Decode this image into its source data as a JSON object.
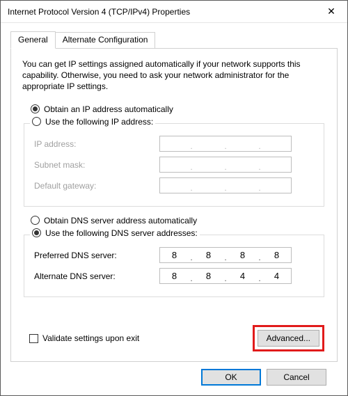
{
  "window": {
    "title": "Internet Protocol Version 4 (TCP/IPv4) Properties"
  },
  "tabs": {
    "general": "General",
    "alternate": "Alternate Configuration"
  },
  "intro": "You can get IP settings assigned automatically if your network supports this capability. Otherwise, you need to ask your network administrator for the appropriate IP settings.",
  "ip": {
    "auto_label": "Obtain an IP address automatically",
    "manual_label": "Use the following IP address:",
    "selected": "auto",
    "fields": {
      "ip_label": "IP address:",
      "subnet_label": "Subnet mask:",
      "gateway_label": "Default gateway:",
      "ip_value": [
        "",
        "",
        "",
        ""
      ],
      "subnet_value": [
        "",
        "",
        "",
        ""
      ],
      "gateway_value": [
        "",
        "",
        "",
        ""
      ]
    }
  },
  "dns": {
    "auto_label": "Obtain DNS server address automatically",
    "manual_label": "Use the following DNS server addresses:",
    "selected": "manual",
    "fields": {
      "preferred_label": "Preferred DNS server:",
      "alternate_label": "Alternate DNS server:",
      "preferred_value": [
        "8",
        "8",
        "8",
        "8"
      ],
      "alternate_value": [
        "8",
        "8",
        "4",
        "4"
      ]
    }
  },
  "validate_label": "Validate settings upon exit",
  "advanced_label": "Advanced...",
  "buttons": {
    "ok": "OK",
    "cancel": "Cancel"
  }
}
